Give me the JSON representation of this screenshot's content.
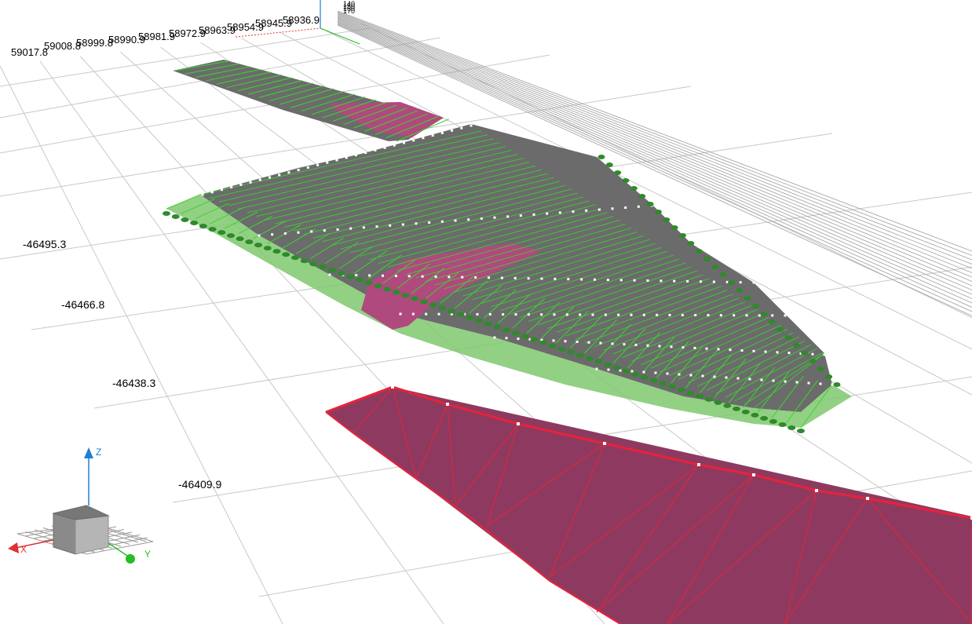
{
  "colors": {
    "background": "#ffffff",
    "grid": "#c8c8c8",
    "terrain_fill": "#6b6b6b",
    "terrain_edges": "#39d62e",
    "slope_fill": "#7fc86e",
    "excavation_fill": "#b0497e",
    "cut_surface_fill": "#8e3a60",
    "cut_surface_edges": "#e8223a",
    "vertex_marker": "#ffffff"
  },
  "x_axis_labels": [
    "59017.8",
    "59008.8",
    "58999.8",
    "58990.9",
    "58981.9",
    "58972.9",
    "58963.9",
    "58954.9",
    "58945.9",
    "58936.9"
  ],
  "y_axis_labels": [
    "-46495.3",
    "-46466.8",
    "-46438.3",
    "-46409.9"
  ],
  "z_axis_labels": [
    "140",
    "150",
    "160",
    "170"
  ],
  "nav_cube": {
    "z_label": "Z",
    "x_label": "X",
    "y_label": "Y",
    "z_color": "#1e7fd8",
    "x_color": "#e03030",
    "y_color": "#22c022"
  }
}
